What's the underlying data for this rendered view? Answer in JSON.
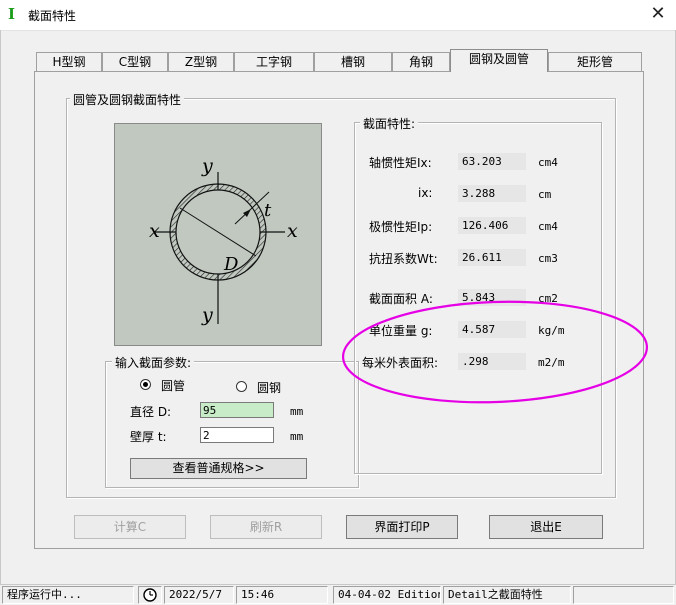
{
  "window": {
    "title": "截面特性",
    "app_icon": "I",
    "close_label": "✕"
  },
  "tabs": [
    {
      "label": "H型钢",
      "active": false
    },
    {
      "label": "C型钢",
      "active": false
    },
    {
      "label": "Z型钢",
      "active": false
    },
    {
      "label": "工字钢",
      "active": false
    },
    {
      "label": "槽钢",
      "active": false
    },
    {
      "label": "角钢",
      "active": false
    },
    {
      "label": "圆钢及圆管",
      "active": true
    },
    {
      "label": "矩形管",
      "active": false
    }
  ],
  "section_group": {
    "title": "圆管及圆钢截面特性"
  },
  "diagram": {
    "y_top": "y",
    "y_bottom": "y",
    "x_left": "x",
    "x_right": "x",
    "thickness": "t",
    "diameter": "D"
  },
  "input_group": {
    "title": "输入截面参数:",
    "radio_tube": "圆管",
    "radio_bar": "圆钢",
    "selected": "圆管",
    "diameter_label": "直径 D:",
    "diameter_value": "95",
    "diameter_unit": "mm",
    "thickness_label": "壁厚 t:",
    "thickness_value": "2",
    "thickness_unit": "mm",
    "view_button": "查看普通规格>>"
  },
  "props_group": {
    "title": "截面特性:",
    "rows": [
      {
        "label": "轴惯性矩Ix:",
        "value": "63.203",
        "unit": "cm4"
      },
      {
        "label": "ix:",
        "value": "3.288",
        "unit": "cm"
      },
      {
        "label": "极惯性矩Ip:",
        "value": "126.406",
        "unit": "cm4"
      },
      {
        "label": "抗扭系数Wt:",
        "value": "26.611",
        "unit": "cm3"
      },
      {
        "label": "截面面积 A:",
        "value": "5.843",
        "unit": "cm2"
      },
      {
        "label": "单位重量 g:",
        "value": "4.587",
        "unit": "kg/m"
      },
      {
        "label": "每米外表面积:",
        "value": ".298",
        "unit": "m2/m"
      }
    ]
  },
  "buttons": {
    "calc": "计算C",
    "refresh": "刷新R",
    "print": "界面打印P",
    "exit": "退出E"
  },
  "statusbar": {
    "status": "程序运行中...",
    "date": "2022/5/7",
    "time": "15:46",
    "edition": "04-04-02 Edition",
    "module": "Detail之截面特性"
  },
  "annotation": {
    "color": "#e600e6"
  },
  "colors": {
    "diagram_bg": "#c0c8c0",
    "value_bg": "#e6e6e6",
    "input_highlight": "#c8ecc8"
  }
}
